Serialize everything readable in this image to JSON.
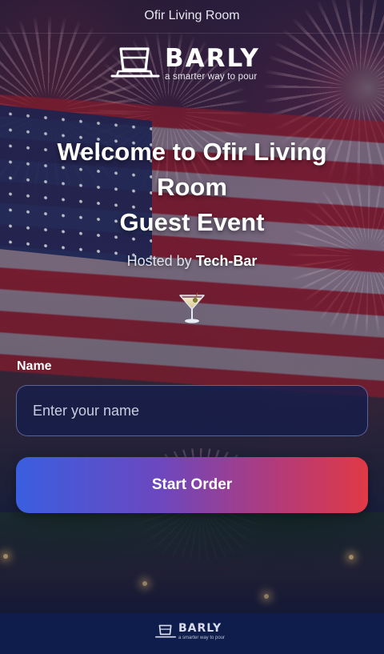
{
  "topbar": {
    "title": "Ofir Living Room"
  },
  "logo": {
    "brand": "BARLY",
    "tagline": "a smarter way to pour",
    "icon": "glass-on-tray-icon"
  },
  "hero": {
    "title_line1": "Welcome to Ofir Living",
    "title_line2": "Room",
    "title_line3": "Guest Event",
    "hosted_prefix": "Hosted by",
    "hosted_by": "Tech-Bar",
    "icon": "martini-glass-icon"
  },
  "form": {
    "name_label": "Name",
    "name_value": "",
    "name_placeholder": "Enter your name",
    "submit_label": "Start Order"
  },
  "footer": {
    "brand": "BARLY",
    "tagline": "a smarter way to pour"
  },
  "colors": {
    "button_gradient_start": "#3a5fe0",
    "button_gradient_end": "#e03a45",
    "input_bg": "#141e4b",
    "footer_bg": "#0f1e50"
  }
}
